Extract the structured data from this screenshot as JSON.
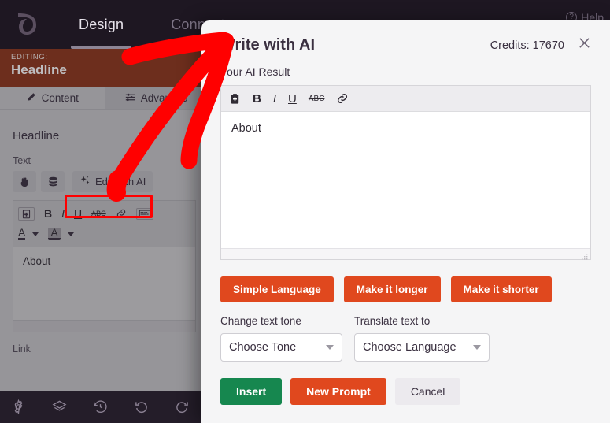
{
  "app": {
    "brand_icon": "leaf-logo",
    "nav": [
      {
        "label": "Design",
        "active": true
      },
      {
        "label": "Connect",
        "active": false
      }
    ],
    "help_label": "Help"
  },
  "editing_banner": {
    "kicker": "EDITING:",
    "title": "Headline"
  },
  "left_panel": {
    "tabs": [
      {
        "label": "Content",
        "icon": "pencil-icon",
        "active": true
      },
      {
        "label": "Advanced",
        "icon": "sliders-icon",
        "active": false
      }
    ],
    "section_title": "Headline",
    "text_label": "Text",
    "personalize_icon": "hand-icon",
    "database_icon": "database-icon",
    "edit_with_ai_label": "Edit with AI",
    "edit_with_ai_icon": "sparkles-icon",
    "editor_toolbar": [
      "paste-icon",
      "bold-icon",
      "italic-icon",
      "underline-icon",
      "strikethrough-icon",
      "link-icon",
      "code-icon"
    ],
    "editor_toolbar_row2": [
      "text-color-icon",
      "highlight-color-icon"
    ],
    "editor_content": "About",
    "link_label": "Link"
  },
  "bottom_toolbar": [
    "settings-gear-icon",
    "layers-icon",
    "history-clock-icon",
    "undo-icon",
    "redo-icon"
  ],
  "modal": {
    "title": "Write with AI",
    "credits": "Credits: 17670",
    "close_icon": "close-icon",
    "subtitle": "Your AI Result",
    "toolbar": [
      "paste-icon",
      "bold-icon",
      "italic-icon",
      "underline-icon",
      "strikethrough-icon",
      "link-icon"
    ],
    "result_text": "About",
    "quick_actions": [
      {
        "label": "Simple Language"
      },
      {
        "label": "Make it longer"
      },
      {
        "label": "Make it shorter"
      }
    ],
    "tone": {
      "label": "Change text tone",
      "value": "Choose Tone"
    },
    "language": {
      "label": "Translate text to",
      "value": "Choose Language"
    },
    "footer_buttons": [
      {
        "label": "Insert",
        "style": "green"
      },
      {
        "label": "New Prompt",
        "style": "orange"
      },
      {
        "label": "Cancel",
        "style": "grey"
      }
    ]
  },
  "annotation": {
    "type": "hand-drawn-arrow",
    "color": "#ff0000",
    "highlight_box_target": "edit-with-ai-button"
  },
  "colors": {
    "accent_orange": "#e0481e",
    "accent_green": "#16874f",
    "banner_brown": "#8c3317",
    "topbar_dark": "#1e1722",
    "annotation_red": "#ff0000"
  }
}
